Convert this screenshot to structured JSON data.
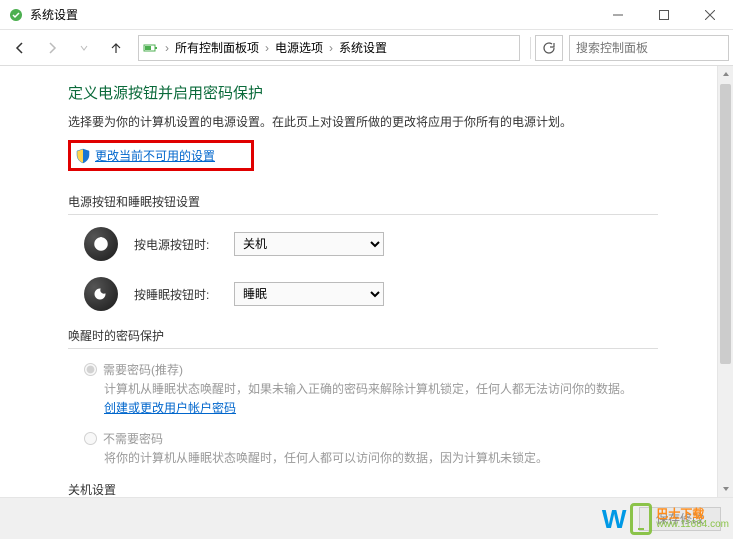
{
  "window": {
    "title": "系统设置"
  },
  "breadcrumb": {
    "items": [
      "所有控制面板项",
      "电源选项",
      "系统设置"
    ]
  },
  "search": {
    "placeholder": "搜索控制面板"
  },
  "page": {
    "heading": "定义电源按钮并启用密码保护",
    "subtitle": "选择要为你的计算机设置的电源设置。在此页上对设置所做的更改将应用于你所有的电源计划。",
    "change_link": "更改当前不可用的设置"
  },
  "section_buttons": {
    "title": "电源按钮和睡眠按钮设置",
    "power_btn_label": "按电源按钮时:",
    "power_btn_value": "关机",
    "sleep_btn_label": "按睡眠按钮时:",
    "sleep_btn_value": "睡眠"
  },
  "section_wake": {
    "title": "唤醒时的密码保护",
    "opt_require": {
      "label": "需要密码(推荐)",
      "desc_before": "计算机从睡眠状态唤醒时，如果未输入正确的密码来解除计算机锁定，任何人都无法访问你的数据。",
      "link": "创建或更改用户帐户密码"
    },
    "opt_norequire": {
      "label": "不需要密码",
      "desc": "将你的计算机从睡眠状态唤醒时，任何人都可以访问你的数据，因为计算机未锁定。"
    }
  },
  "section_shutdown": {
    "title": "关机设置"
  },
  "footer": {
    "save": "保存修改"
  },
  "watermark": {
    "line1": "巴士下载",
    "line2": "www.11684.com"
  }
}
